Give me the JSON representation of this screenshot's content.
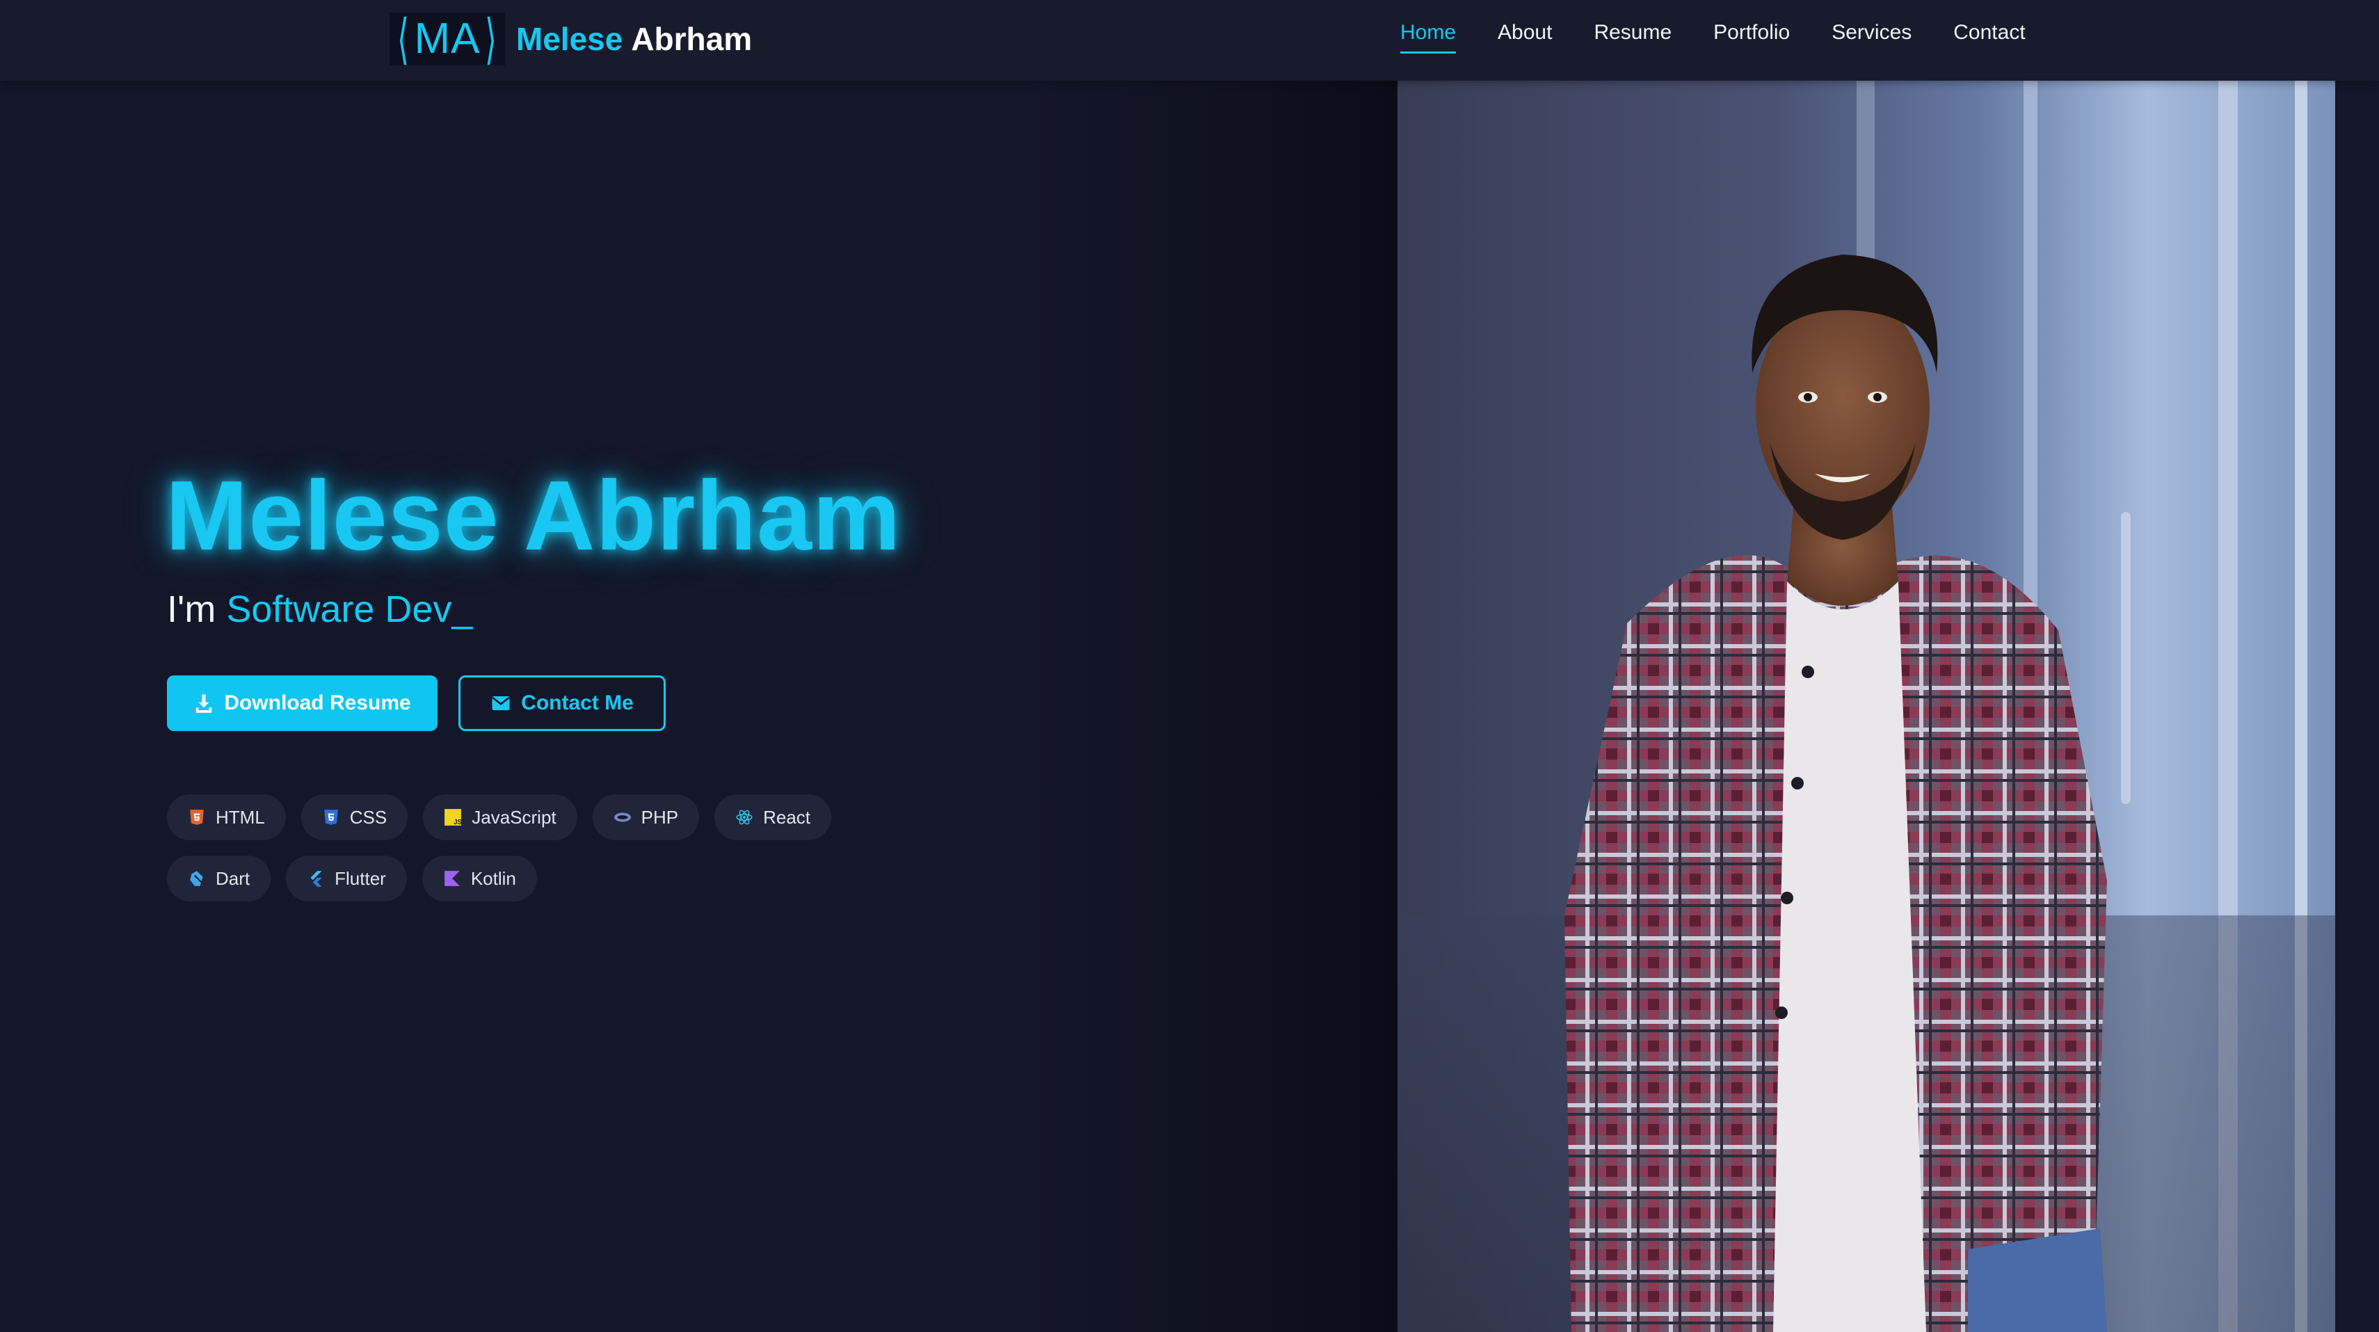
{
  "nav": {
    "logo_mark_left": "⟨",
    "logo_mark_text": "MA",
    "logo_mark_right": "⟩",
    "logo_first": "Melese",
    "logo_last": "Abrham",
    "links": [
      {
        "label": "Home",
        "active": true
      },
      {
        "label": "About",
        "active": false
      },
      {
        "label": "Resume",
        "active": false
      },
      {
        "label": "Portfolio",
        "active": false
      },
      {
        "label": "Services",
        "active": false
      },
      {
        "label": "Contact",
        "active": false
      }
    ]
  },
  "hero": {
    "name": "Melese Abrham",
    "role_prefix": "I'm",
    "role_typed": "Software Dev",
    "cursor": "_",
    "download_label": "Download Resume",
    "contact_label": "Contact Me",
    "skills_row1": [
      {
        "label": "HTML",
        "icon": "html5-icon"
      },
      {
        "label": "CSS",
        "icon": "css3-icon"
      },
      {
        "label": "JavaScript",
        "icon": "javascript-icon"
      },
      {
        "label": "PHP",
        "icon": "php-icon"
      },
      {
        "label": "React",
        "icon": "react-icon"
      }
    ],
    "skills_row2": [
      {
        "label": "Dart",
        "icon": "dart-icon"
      },
      {
        "label": "Flutter",
        "icon": "flutter-icon"
      },
      {
        "label": "Kotlin",
        "icon": "kotlin-icon"
      }
    ]
  },
  "colors": {
    "accent": "#18c8f2",
    "background": "#141729",
    "navbar": "#181b2c",
    "chip": "#21253a"
  },
  "photo": {
    "icon": "portrait-photo"
  }
}
